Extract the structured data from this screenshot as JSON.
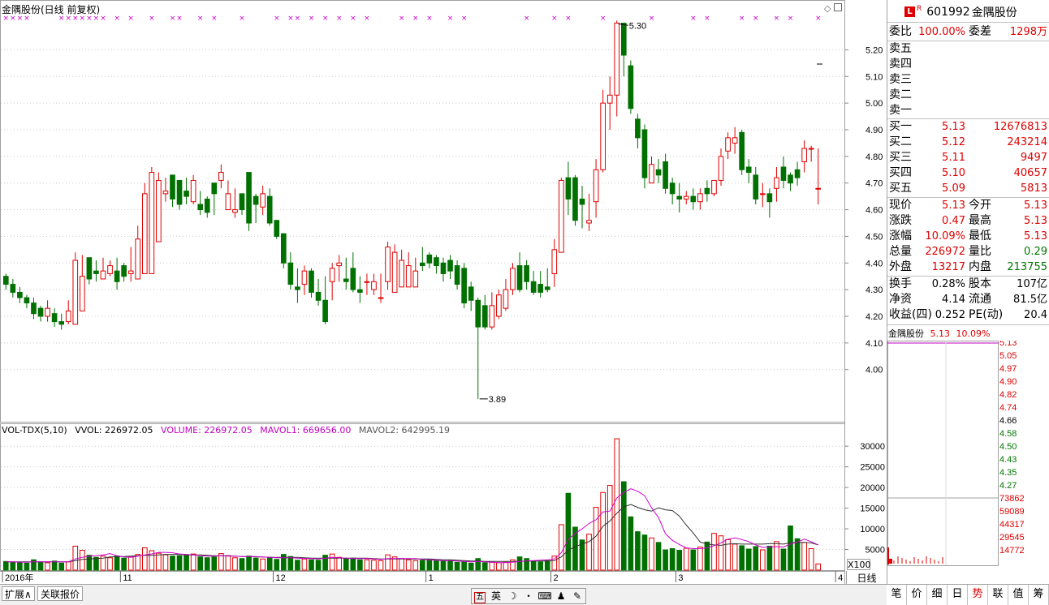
{
  "header": {
    "title": "金隅股份(日线 前复权)"
  },
  "kline": {
    "high_marker": "5.30",
    "low_marker": "3.89",
    "y_ticks": [
      "5.20",
      "5.10",
      "5.00",
      "4.90",
      "4.80",
      "4.70",
      "4.60",
      "4.50",
      "4.40",
      "4.30",
      "4.20",
      "4.10",
      "4.00"
    ],
    "y_range": [
      3.85,
      5.32
    ],
    "colors": {
      "up": "#e00000",
      "down": "#007000",
      "marker": "#cc00cc"
    }
  },
  "volume": {
    "header": {
      "name": "VOL-TDX(5,10)",
      "vvol": "VVOL: 226972.05",
      "volume": "VOLUME: 226972.05",
      "mavol1": "MAVOL1: 669656.00",
      "mavol2": "MAVOL2: 642995.19"
    },
    "y_ticks": [
      "30000",
      "25000",
      "20000",
      "15000",
      "10000",
      "5000"
    ],
    "y_range": [
      0,
      32000
    ],
    "colors": {
      "ma1": "#d000d0",
      "ma2": "#333333"
    }
  },
  "x_axis": {
    "labels": [
      {
        "label": "2016年",
        "index": 0
      },
      {
        "label": "11",
        "index": 17
      },
      {
        "label": "12",
        "index": 39
      },
      {
        "label": "1",
        "index": 61
      },
      {
        "label": "2",
        "index": 79
      },
      {
        "label": "3",
        "index": 97
      },
      {
        "label": "4",
        "index": 120
      }
    ]
  },
  "bottom_tabs": {
    "expand": "扩展∧",
    "related": "关联报价"
  },
  "ime": {
    "items": [
      "五",
      "英",
      "☽",
      "・",
      "⌨",
      "♟",
      "✎"
    ]
  },
  "period_label": "日线",
  "x100_label": "X100",
  "quote": {
    "badge": "L",
    "badge_sup": "R",
    "code": "601992",
    "name": "金隅股份",
    "weibi_label": "委比",
    "weibi": "100.00%",
    "weicha_label": "委差",
    "weicha": "1298万",
    "sell": [
      {
        "label": "卖五"
      },
      {
        "label": "卖四"
      },
      {
        "label": "卖三"
      },
      {
        "label": "卖二"
      },
      {
        "label": "卖一"
      }
    ],
    "buy": [
      {
        "label": "买一",
        "price": "5.13",
        "vol": "12676813"
      },
      {
        "label": "买二",
        "price": "5.12",
        "vol": "243214"
      },
      {
        "label": "买三",
        "price": "5.11",
        "vol": "9497"
      },
      {
        "label": "买四",
        "price": "5.10",
        "vol": "40657"
      },
      {
        "label": "买五",
        "price": "5.09",
        "vol": "5813"
      }
    ],
    "stats": [
      {
        "l1": "现价",
        "v1": "5.13",
        "l2": "今开",
        "v2": "5.13",
        "c1": "red",
        "c2": "red"
      },
      {
        "l1": "涨跌",
        "v1": "0.47",
        "l2": "最高",
        "v2": "5.13",
        "c1": "red",
        "c2": "red"
      },
      {
        "l1": "涨幅",
        "v1": "10.09%",
        "l2": "最低",
        "v2": "5.13",
        "c1": "red",
        "c2": "red"
      },
      {
        "l1": "总量",
        "v1": "226972",
        "l2": "量比",
        "v2": "0.29",
        "c1": "red",
        "c2": "grn"
      },
      {
        "l1": "外盘",
        "v1": "13217",
        "l2": "内盘",
        "v2": "213755",
        "c1": "red",
        "c2": "grn"
      }
    ],
    "fund": [
      {
        "l1": "换手",
        "v1": "0.28%",
        "l2": "股本",
        "v2": "107亿"
      },
      {
        "l1": "净资",
        "v1": "4.14",
        "l2": "流通",
        "v2": "81.5亿"
      },
      {
        "l1": "收益(四)",
        "v1": "0.252",
        "l2": "PE(动)",
        "v2": "20.4"
      }
    ]
  },
  "mini_chart": {
    "name": "金隅股份",
    "price": "5.13",
    "pct": "10.09%",
    "price_ticks": [
      {
        "v": "5.13",
        "c": "red"
      },
      {
        "v": "5.05",
        "c": "red"
      },
      {
        "v": "4.97",
        "c": "red"
      },
      {
        "v": "4.90",
        "c": "red"
      },
      {
        "v": "4.82",
        "c": "red"
      },
      {
        "v": "4.74",
        "c": "red"
      },
      {
        "v": "4.66",
        "c": "blk"
      },
      {
        "v": "4.58",
        "c": "grn"
      },
      {
        "v": "4.50",
        "c": "grn"
      },
      {
        "v": "4.43",
        "c": "grn"
      },
      {
        "v": "4.35",
        "c": "grn"
      },
      {
        "v": "4.27",
        "c": "grn"
      }
    ],
    "vol_ticks": [
      "73862",
      "59089",
      "44317",
      "29545",
      "14772"
    ]
  },
  "right_tabs": [
    "笔",
    "价",
    "细",
    "日",
    "势",
    "联",
    "值",
    "筹"
  ],
  "right_tab_active": "势",
  "chart_data": {
    "type": "candlestick",
    "open": [
      4.35,
      4.32,
      4.29,
      4.27,
      4.25,
      4.23,
      4.2,
      4.21,
      4.18,
      4.18,
      4.17,
      4.22,
      4.42,
      4.37,
      4.34,
      4.36,
      4.37,
      4.39,
      4.36,
      4.34,
      4.36,
      4.36,
      4.48,
      4.66,
      4.73,
      4.71,
      4.67,
      4.63,
      4.62,
      4.64,
      4.7,
      4.71,
      4.6,
      4.59,
      4.66,
      4.74,
      4.65,
      4.61,
      4.65,
      4.56,
      4.51,
      4.4,
      4.31,
      4.32,
      4.37,
      4.29,
      4.26,
      4.33,
      4.39,
      4.34,
      4.38,
      4.3,
      4.33,
      4.3,
      4.27,
      4.33,
      4.29,
      4.31,
      4.31,
      4.31,
      4.4,
      4.43,
      4.42,
      4.4,
      4.41,
      4.39,
      4.38,
      4.31,
      4.26,
      4.24,
      4.16,
      4.2,
      4.23,
      4.3,
      4.39,
      4.39,
      4.33,
      4.32,
      4.31,
      4.36,
      4.44,
      4.72,
      4.72,
      4.64,
      4.55,
      4.63,
      4.75,
      5.0,
      5.03,
      5.3,
      5.14,
      4.94,
      4.9,
      4.7,
      4.75,
      4.78,
      4.7,
      4.65,
      4.64,
      4.65,
      4.63,
      4.68,
      4.66,
      4.71,
      4.82,
      4.85,
      4.89,
      4.76,
      4.73,
      4.66,
      4.66,
      4.68,
      4.76,
      4.73,
      4.75,
      4.78,
      4.83,
      4.68
    ],
    "close": [
      4.32,
      4.29,
      4.27,
      4.25,
      4.21,
      4.2,
      4.23,
      4.18,
      4.17,
      4.22,
      4.41,
      4.35,
      4.34,
      4.36,
      4.37,
      4.39,
      4.33,
      4.35,
      4.37,
      4.49,
      4.66,
      4.74,
      4.71,
      4.67,
      4.64,
      4.62,
      4.65,
      4.71,
      4.6,
      4.59,
      4.66,
      4.74,
      4.66,
      4.6,
      4.6,
      4.55,
      4.62,
      4.66,
      4.55,
      4.5,
      4.4,
      4.32,
      4.3,
      4.37,
      4.29,
      4.26,
      4.18,
      4.38,
      4.4,
      4.33,
      4.3,
      4.29,
      4.33,
      4.33,
      4.27,
      4.46,
      4.44,
      4.41,
      4.39,
      4.37,
      4.39,
      4.4,
      4.39,
      4.36,
      4.37,
      4.32,
      4.25,
      4.26,
      4.16,
      4.16,
      4.24,
      4.28,
      4.3,
      4.38,
      4.3,
      4.33,
      4.29,
      4.29,
      4.3,
      4.45,
      4.71,
      4.64,
      4.56,
      4.62,
      4.56,
      4.75,
      5.0,
      5.03,
      5.3,
      5.18,
      4.98,
      4.87,
      4.72,
      4.77,
      4.73,
      4.68,
      4.66,
      4.64,
      4.65,
      4.63,
      4.66,
      4.66,
      4.71,
      4.8,
      4.87,
      4.87,
      4.75,
      4.74,
      4.64,
      4.66,
      4.63,
      4.72,
      4.71,
      4.7,
      4.72,
      4.83,
      4.83,
      4.68
    ],
    "high": [
      4.36,
      4.34,
      4.31,
      4.28,
      4.27,
      4.24,
      4.26,
      4.23,
      4.21,
      4.26,
      4.44,
      4.43,
      4.39,
      4.41,
      4.42,
      4.41,
      4.42,
      4.4,
      4.46,
      4.54,
      4.7,
      4.76,
      4.74,
      4.72,
      4.7,
      4.68,
      4.72,
      4.73,
      4.67,
      4.65,
      4.69,
      4.77,
      4.71,
      4.68,
      4.66,
      4.66,
      4.66,
      4.69,
      4.68,
      4.55,
      4.51,
      4.44,
      4.38,
      4.39,
      4.38,
      4.34,
      4.35,
      4.4,
      4.43,
      4.42,
      4.44,
      4.35,
      4.36,
      4.36,
      4.36,
      4.48,
      4.47,
      4.45,
      4.44,
      4.42,
      4.46,
      4.44,
      4.43,
      4.42,
      4.43,
      4.41,
      4.4,
      4.33,
      4.27,
      4.28,
      4.29,
      4.3,
      4.34,
      4.4,
      4.44,
      4.41,
      4.37,
      4.37,
      4.38,
      4.49,
      4.72,
      4.78,
      4.73,
      4.69,
      4.66,
      4.79,
      5.05,
      5.1,
      5.31,
      5.3,
      5.16,
      4.96,
      4.92,
      4.8,
      4.79,
      4.81,
      4.72,
      4.7,
      4.67,
      4.68,
      4.68,
      4.71,
      4.7,
      4.83,
      4.89,
      4.91,
      4.9,
      4.79,
      4.76,
      4.7,
      4.68,
      4.76,
      4.8,
      4.74,
      4.78,
      4.86,
      4.84,
      4.83
    ],
    "low": [
      4.3,
      4.27,
      4.25,
      4.23,
      4.19,
      4.18,
      4.18,
      4.16,
      4.15,
      4.17,
      4.17,
      4.31,
      4.32,
      4.33,
      4.34,
      4.35,
      4.3,
      4.33,
      4.33,
      4.34,
      4.36,
      4.64,
      4.65,
      4.63,
      4.61,
      4.6,
      4.62,
      4.62,
      4.58,
      4.57,
      4.58,
      4.68,
      4.62,
      4.57,
      4.58,
      4.52,
      4.55,
      4.58,
      4.54,
      4.49,
      4.38,
      4.3,
      4.25,
      4.28,
      4.27,
      4.24,
      4.17,
      4.26,
      4.33,
      4.3,
      4.29,
      4.25,
      4.28,
      4.28,
      4.25,
      4.3,
      4.39,
      4.38,
      4.36,
      4.34,
      4.37,
      4.38,
      4.36,
      4.33,
      4.34,
      4.3,
      4.23,
      4.22,
      3.89,
      4.15,
      4.15,
      4.19,
      4.22,
      4.28,
      4.29,
      4.3,
      4.28,
      4.27,
      4.29,
      4.31,
      4.45,
      4.58,
      4.54,
      4.53,
      4.52,
      4.57,
      4.74,
      4.9,
      4.95,
      5.1,
      4.96,
      4.83,
      4.68,
      4.7,
      4.7,
      4.66,
      4.62,
      4.59,
      4.62,
      4.6,
      4.6,
      4.63,
      4.65,
      4.69,
      4.79,
      4.81,
      4.73,
      4.7,
      4.62,
      4.61,
      4.57,
      4.63,
      4.68,
      4.67,
      4.69,
      4.74,
      4.78,
      4.62
    ],
    "volume": [
      2100,
      1900,
      1800,
      1700,
      2500,
      2000,
      1800,
      2200,
      1700,
      2000,
      5800,
      4800,
      3600,
      3100,
      3400,
      3000,
      3400,
      2900,
      3300,
      3800,
      5400,
      4700,
      4100,
      3700,
      3400,
      3500,
      3600,
      3900,
      3200,
      3000,
      3200,
      4000,
      3500,
      3000,
      2800,
      3400,
      2900,
      2700,
      3100,
      2600,
      3800,
      3300,
      2400,
      2700,
      2500,
      2400,
      3600,
      3900,
      3100,
      2800,
      2900,
      2500,
      2500,
      2400,
      2300,
      3700,
      3200,
      2800,
      2500,
      2300,
      2400,
      2500,
      2300,
      2200,
      2300,
      1900,
      2000,
      1700,
      2800,
      1800,
      1900,
      1800,
      1900,
      2500,
      3200,
      2800,
      2200,
      2000,
      2300,
      3400,
      11000,
      18600,
      10400,
      7300,
      8700,
      15200,
      18800,
      20500,
      31800,
      21400,
      12900,
      9300,
      8500,
      7800,
      6700,
      4900,
      5200,
      4800,
      5300,
      4900,
      5600,
      6800,
      8900,
      8300,
      7400,
      6300,
      5900,
      5100,
      5700,
      4900,
      5800,
      6900,
      5100,
      10700,
      7600,
      6700,
      5200,
      1500
    ],
    "ma1": [
      2050,
      2000,
      1950,
      1900,
      2000,
      2000,
      2000,
      2000,
      2000,
      2000,
      2700,
      3100,
      3400,
      3500,
      3700,
      4000,
      3500,
      3200,
      3100,
      3400,
      3700,
      3900,
      4300,
      4300,
      4200,
      3900,
      3800,
      3700,
      3500,
      3400,
      3400,
      3500,
      3400,
      3400,
      3300,
      3300,
      3300,
      3200,
      3100,
      3000,
      3000,
      3000,
      2900,
      2800,
      2800,
      2700,
      2900,
      3100,
      3000,
      2900,
      2800,
      2800,
      2800,
      2700,
      2600,
      2800,
      2800,
      2800,
      2800,
      2800,
      2600,
      2500,
      2400,
      2300,
      2300,
      2200,
      2100,
      2000,
      2100,
      2000,
      1900,
      1800,
      1800,
      1900,
      2100,
      2200,
      2300,
      2400,
      2500,
      2700,
      4200,
      7400,
      8900,
      10000,
      11300,
      12200,
      14100,
      14300,
      17500,
      18800,
      19700,
      19100,
      18000,
      15100,
      12700,
      8800,
      7200,
      6200,
      5400,
      5200,
      5200,
      5400,
      5900,
      6600,
      7500,
      7800,
      7400,
      6900,
      6100,
      5500,
      5600,
      5700,
      5600,
      6300,
      6800,
      7500,
      6900,
      6100
    ],
    "ma2": [
      2000,
      2000,
      2000,
      2000,
      2000,
      2000,
      2000,
      2000,
      2000,
      2000,
      2300,
      2600,
      2700,
      2800,
      2900,
      3200,
      3300,
      3300,
      3400,
      3500,
      3600,
      3600,
      3700,
      3800,
      3800,
      3800,
      3700,
      3700,
      3700,
      3600,
      3500,
      3500,
      3500,
      3400,
      3300,
      3300,
      3200,
      3200,
      3100,
      3100,
      3100,
      3100,
      3100,
      3000,
      2900,
      2900,
      2900,
      2900,
      2900,
      2900,
      2900,
      2900,
      2900,
      2800,
      2700,
      2700,
      2700,
      2700,
      2700,
      2700,
      2700,
      2700,
      2600,
      2500,
      2500,
      2400,
      2300,
      2200,
      2200,
      2100,
      2100,
      2100,
      2100,
      2100,
      2100,
      2200,
      2200,
      2200,
      2200,
      2300,
      3200,
      4800,
      5700,
      6300,
      6900,
      8200,
      10600,
      11900,
      13800,
      15300,
      15900,
      15200,
      14600,
      14300,
      15100,
      14600,
      14400,
      13100,
      10900,
      9000,
      6800,
      6300,
      6100,
      6000,
      6300,
      6400,
      6300,
      6300,
      6300,
      6300,
      6400,
      6400,
      6300,
      6600,
      6700,
      6700,
      6600,
      6100
    ],
    "top_markers": [
      0,
      1,
      2,
      3,
      8,
      9,
      10,
      11,
      12,
      13,
      14,
      16,
      18,
      21,
      24,
      25,
      28,
      30,
      34,
      39,
      41,
      42,
      44,
      46,
      48,
      50,
      52,
      57,
      59,
      61,
      64,
      66,
      75,
      79,
      81,
      86,
      93,
      99,
      101,
      106,
      108,
      111,
      113,
      117
    ]
  }
}
